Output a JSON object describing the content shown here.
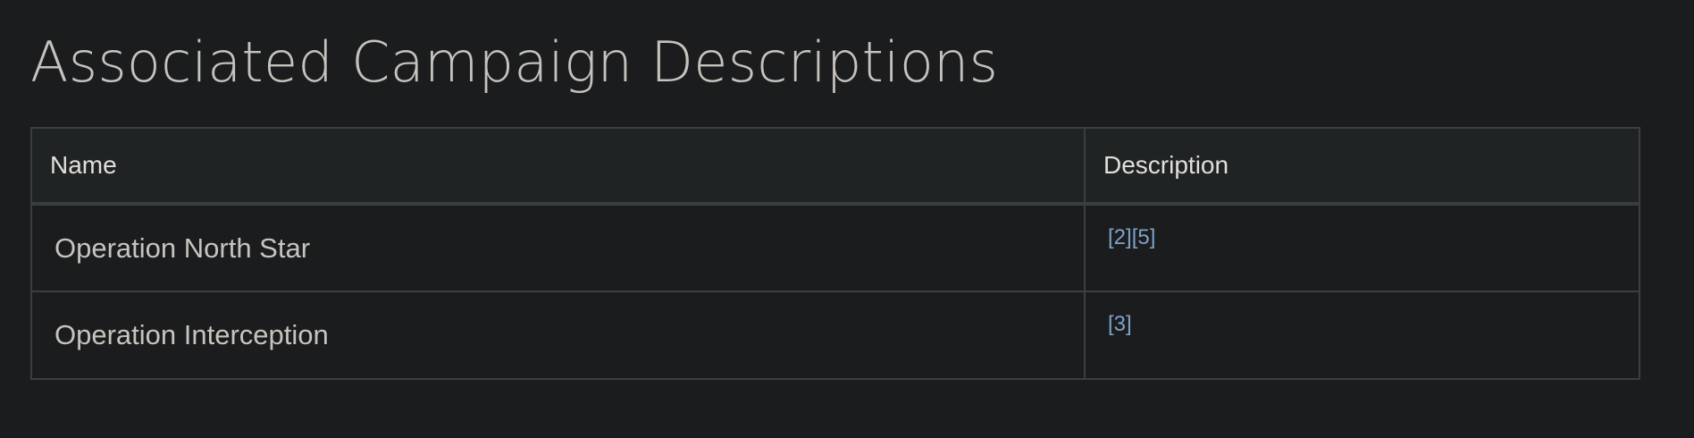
{
  "page": {
    "title": "Associated Campaign Descriptions"
  },
  "table": {
    "headers": {
      "name": "Name",
      "description": "Description"
    },
    "rows": [
      {
        "name": "Operation North Star",
        "refs": [
          "[2]",
          "[5]"
        ]
      },
      {
        "name": "Operation Interception",
        "refs": [
          "[3]"
        ]
      }
    ]
  },
  "colors": {
    "background": "#1b1c1e",
    "link": "#7ea3c8",
    "header_bg": "#202324",
    "border": "#3b3f42"
  }
}
